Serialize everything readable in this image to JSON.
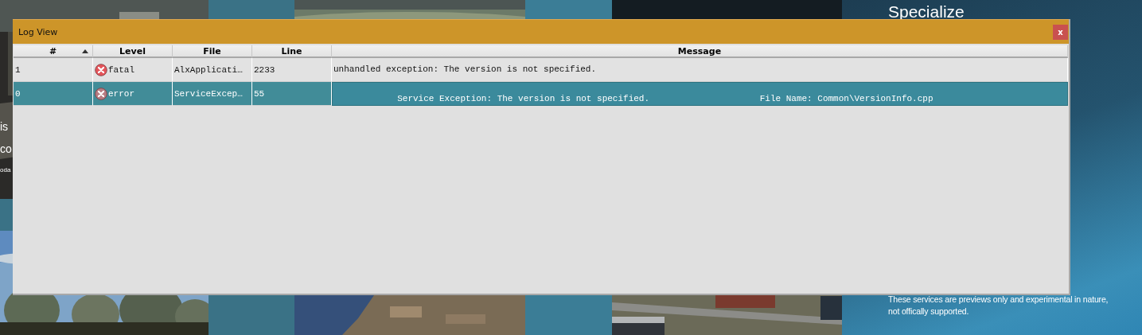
{
  "background": {
    "left_texts": [
      {
        "kind": "large",
        "text": "is"
      },
      {
        "kind": "large",
        "text": "co"
      },
      {
        "kind": "small",
        "text": "oda"
      }
    ],
    "heading": "Specialize",
    "notes": [
      "These services are previews only and experimental in nature,",
      "not offically supported."
    ]
  },
  "window": {
    "title": "Log View",
    "close": "x"
  },
  "table": {
    "columns": [
      {
        "label": "#",
        "sorted": true
      },
      {
        "label": "Level",
        "sorted": false
      },
      {
        "label": "File",
        "sorted": false
      },
      {
        "label": "Line",
        "sorted": false
      },
      {
        "label": "Message",
        "sorted": false
      }
    ],
    "rows": [
      {
        "selected": false,
        "number": "1",
        "level": {
          "kind": "fatal",
          "text": "fatal"
        },
        "file": "AlxApplicati…",
        "line": "2233",
        "message": "unhandled exception: The version is not specified."
      },
      {
        "selected": true,
        "number": "0",
        "level": {
          "kind": "error",
          "text": "error"
        },
        "file": "ServiceExcep…",
        "line": "55",
        "message": "\n            Service Exception: The version is not specified.                     File Name: Common\\VersionInfo.cpp"
      }
    ]
  }
}
